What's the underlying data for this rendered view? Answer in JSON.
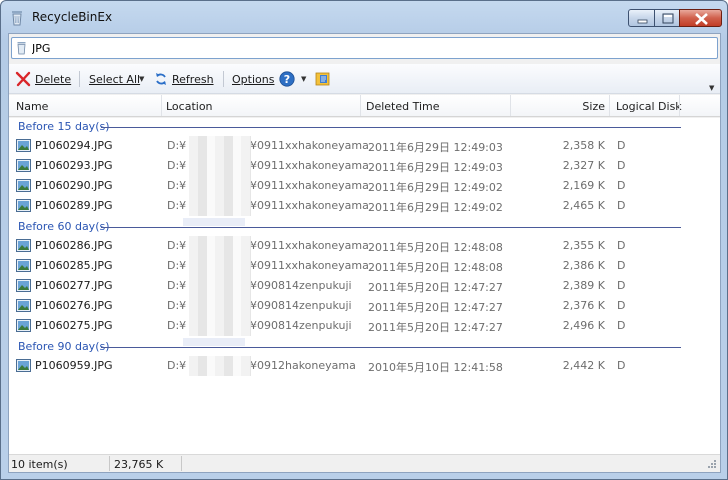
{
  "window": {
    "title": "RecycleBinEx"
  },
  "search": {
    "value": "JPG"
  },
  "toolbar": {
    "delete_label": "Delete",
    "select_all_label": "Select All",
    "refresh_label": "Refresh",
    "options_label": "Options"
  },
  "columns": {
    "name": "Name",
    "location": "Location",
    "deleted_time": "Deleted Time",
    "size": "Size",
    "logical_disk": "Logical Disk"
  },
  "groups": [
    {
      "label": "Before 15 day(s)",
      "items": [
        {
          "name": "P1060294.JPG",
          "loc_prefix": "D:¥",
          "loc_suffix": "¥0911xxhakoneyama",
          "deleted": "2011年6月29日  12:49:03",
          "size": "2,358 K",
          "disk": "D"
        },
        {
          "name": "P1060293.JPG",
          "loc_prefix": "D:¥",
          "loc_suffix": "¥0911xxhakoneyama",
          "deleted": "2011年6月29日  12:49:03",
          "size": "2,327 K",
          "disk": "D"
        },
        {
          "name": "P1060290.JPG",
          "loc_prefix": "D:¥",
          "loc_suffix": "¥0911xxhakoneyama",
          "deleted": "2011年6月29日  12:49:02",
          "size": "2,169 K",
          "disk": "D"
        },
        {
          "name": "P1060289.JPG",
          "loc_prefix": "D:¥",
          "loc_suffix": "¥0911xxhakoneyama",
          "deleted": "2011年6月29日  12:49:02",
          "size": "2,465 K",
          "disk": "D"
        }
      ]
    },
    {
      "label": "Before 60 day(s)",
      "items": [
        {
          "name": "P1060286.JPG",
          "loc_prefix": "D:¥",
          "loc_suffix": "¥0911xxhakoneyama",
          "deleted": "2011年5月20日  12:48:08",
          "size": "2,355 K",
          "disk": "D"
        },
        {
          "name": "P1060285.JPG",
          "loc_prefix": "D:¥",
          "loc_suffix": "¥0911xxhakoneyama",
          "deleted": "2011年5月20日  12:48:08",
          "size": "2,386 K",
          "disk": "D"
        },
        {
          "name": "P1060277.JPG",
          "loc_prefix": "D:¥",
          "loc_suffix": "¥090814zenpukuji",
          "deleted": "2011年5月20日  12:47:27",
          "size": "2,389 K",
          "disk": "D"
        },
        {
          "name": "P1060276.JPG",
          "loc_prefix": "D:¥",
          "loc_suffix": "¥090814zenpukuji",
          "deleted": "2011年5月20日  12:47:27",
          "size": "2,376 K",
          "disk": "D"
        },
        {
          "name": "P1060275.JPG",
          "loc_prefix": "D:¥",
          "loc_suffix": "¥090814zenpukuji",
          "deleted": "2011年5月20日  12:47:27",
          "size": "2,496 K",
          "disk": "D"
        }
      ]
    },
    {
      "label": "Before 90 day(s)",
      "items": [
        {
          "name": "P1060959.JPG",
          "loc_prefix": "D:¥",
          "loc_suffix": "¥0912hakoneyama",
          "deleted": "2010年5月10日  12:41:58",
          "size": "2,442 K",
          "disk": "D"
        }
      ]
    }
  ],
  "status": {
    "item_count": "10 item(s)",
    "total_size": "23,765 K"
  },
  "icons": {
    "app": "recycle-bin-icon",
    "search": "recycle-bin-icon",
    "delete": "delete-x-icon",
    "refresh": "refresh-arrows-icon",
    "help": "help-question-icon",
    "extra": "notes-icon",
    "file": "image-file-icon"
  },
  "colors": {
    "group_label": "#2a55b3",
    "group_line": "#4a5a9a",
    "delete_icon": "#d9262a",
    "help_icon": "#2d6fc4"
  }
}
